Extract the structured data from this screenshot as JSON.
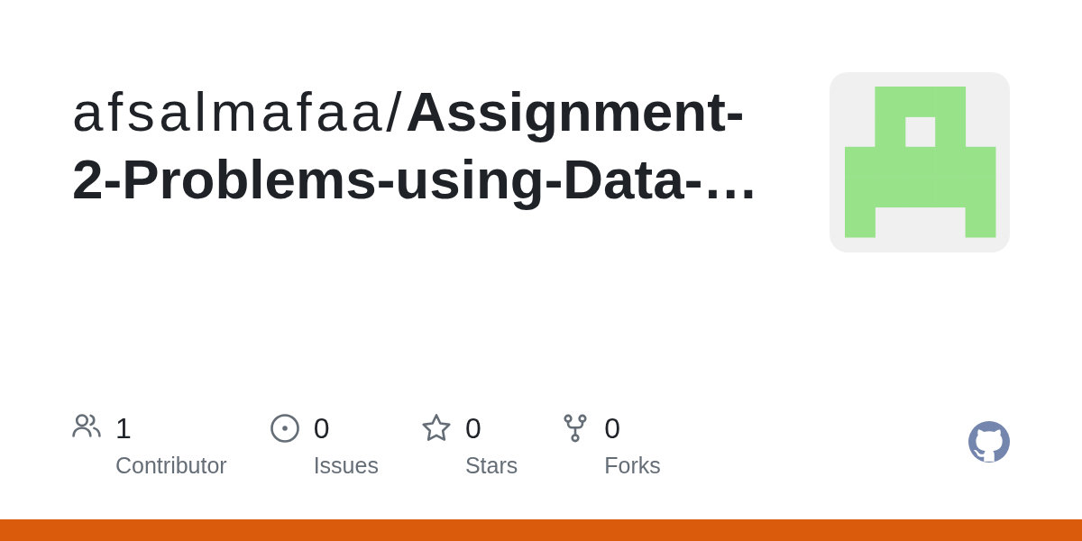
{
  "title": "afsalmafaa/**Assignment-2-Problems-using-Data-…**",
  "stats": [
    {
      "kind": "contributors",
      "value": "1",
      "label": "Contributor"
    },
    {
      "kind": "issues",
      "value": "0",
      "label": "Issues"
    },
    {
      "kind": "stars",
      "value": "0",
      "label": "Stars"
    },
    {
      "kind": "forks",
      "value": "0",
      "label": "Forks"
    }
  ],
  "language_bar": [
    {
      "color": "#da5b0b",
      "level": 1
    }
  ]
}
